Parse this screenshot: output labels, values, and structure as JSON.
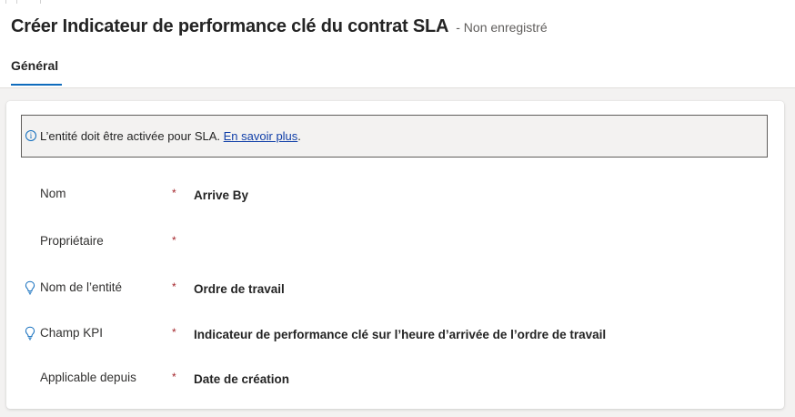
{
  "header": {
    "title": "Créer Indicateur de performance clé du contrat SLA",
    "status": "- Non enregistré"
  },
  "tabs": [
    {
      "label": "Général",
      "active": true
    }
  ],
  "notice": {
    "info_icon": "info-icon",
    "text": "L’entité doit être activée pour SLA. ",
    "link": "En savoir plus",
    "suffix": "."
  },
  "fields": [
    {
      "label": "Nom",
      "required": "*",
      "value": "Arrive By",
      "icon": ""
    },
    {
      "label": "Propriétaire",
      "required": "*",
      "value": "",
      "icon": ""
    },
    {
      "label": "Nom de l’entité",
      "required": "*",
      "value": "Ordre de travail",
      "icon": "lightbulb-icon"
    },
    {
      "label": "Champ KPI",
      "required": "*",
      "value": "Indicateur de performance clé sur l’heure d’arrivée de l’ordre de travail",
      "icon": "lightbulb-icon"
    },
    {
      "label": "Applicable depuis",
      "required": "*",
      "value": "Date de création",
      "icon": ""
    }
  ],
  "colors": {
    "accent": "#0f6cbd",
    "required": "#a4262c",
    "link": "#0f3ea8"
  }
}
